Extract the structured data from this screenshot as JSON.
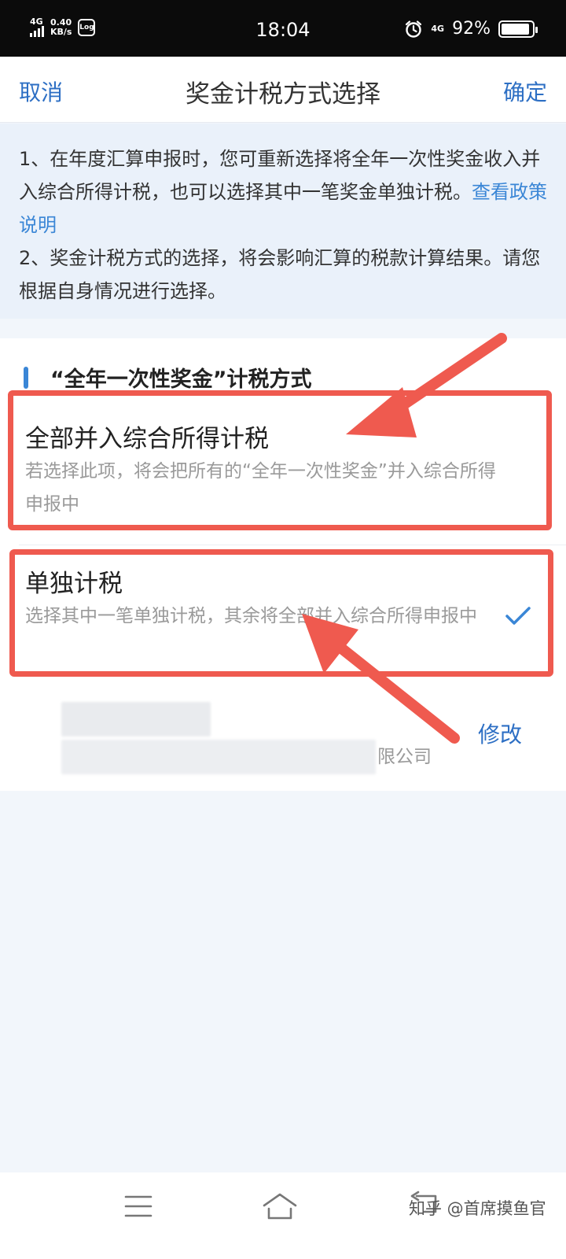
{
  "status_bar": {
    "network": "4G",
    "speed_value": "0.40",
    "speed_unit": "KB/s",
    "app_badge": "Log",
    "time": "18:04",
    "network_right": "4G",
    "battery": "92%",
    "battery_level": 0.92
  },
  "nav": {
    "cancel": "取消",
    "title": "奖金计税方式选择",
    "confirm": "确定"
  },
  "notice": {
    "line1": "1、在年度汇算申报时，您可重新选择将全年一次性奖金收入并入综合所得计税，也可以选择其中一笔奖金单独计税。",
    "link": "查看政策说明",
    "line2": "2、奖金计税方式的选择，将会影响汇算的税款计算结果。请您根据自身情况进行选择。"
  },
  "section": {
    "title": "“全年一次性奖金”计税方式",
    "options": [
      {
        "title": "全部并入综合所得计税",
        "desc": "若选择此项，将会把所有的“全年一次性奖金”并入综合所得申报中",
        "selected": false
      },
      {
        "title": "单独计税",
        "desc": "选择其中一笔单独计税，其余将全部并入综合所得申报中",
        "selected": true
      }
    ],
    "company_suffix": "限公司",
    "edit": "修改"
  },
  "annotation_color": "#ef5a4f",
  "accent_color": "#2d6fc4",
  "watermark": "知乎 @首席摸鱼官"
}
